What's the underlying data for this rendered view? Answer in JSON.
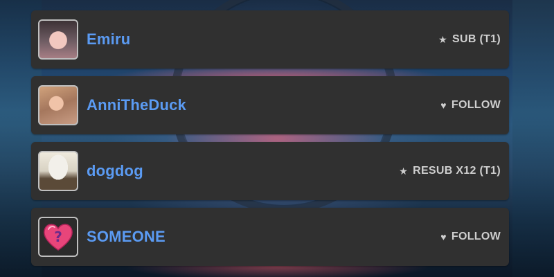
{
  "alerts": [
    {
      "username": "Emiru",
      "avatar_icon": "photo-avatar",
      "event_icon": "star-icon",
      "event_glyph": "★",
      "event_text": "SUB (T1)"
    },
    {
      "username": "AnniTheDuck",
      "avatar_icon": "photo-avatar",
      "event_icon": "heart-icon",
      "event_glyph": "♥",
      "event_text": "FOLLOW"
    },
    {
      "username": "dogdog",
      "avatar_icon": "dog-avatar",
      "event_icon": "star-icon",
      "event_glyph": "★",
      "event_text": "RESUB X12 (T1)"
    },
    {
      "username": "SOMEONE",
      "avatar_icon": "heart-question-avatar",
      "event_icon": "heart-icon",
      "event_glyph": "♥",
      "event_text": "FOLLOW"
    }
  ],
  "colors": {
    "card_bg": "#303030",
    "username": "#5b9bf3",
    "event_text": "#cfcfcf",
    "avatar_border": "#bfbfbf"
  }
}
